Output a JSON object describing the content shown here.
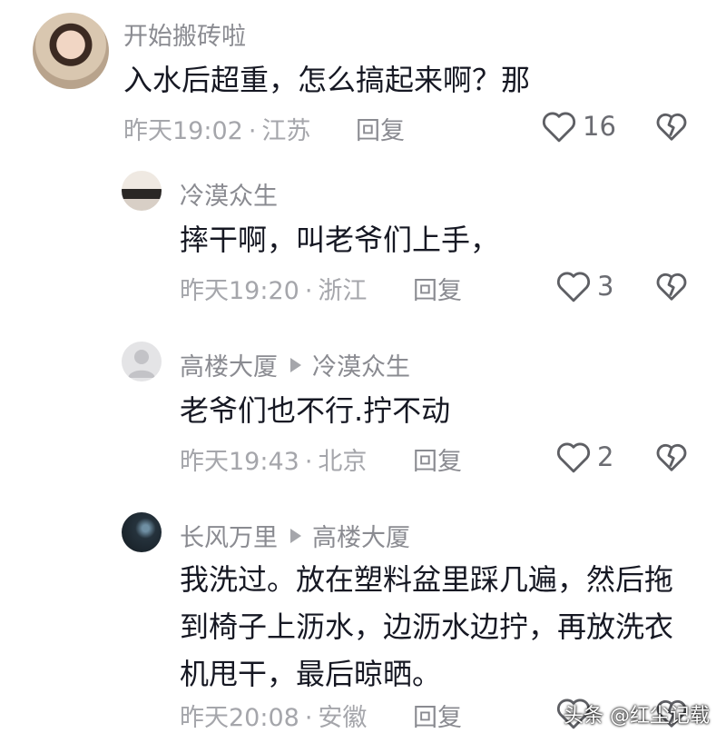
{
  "comments": [
    {
      "username": "开始搬砖啦",
      "text": "入水后超重，怎么搞起来啊？那",
      "time": "昨天19:02",
      "location": "江苏",
      "reply_label": "回复",
      "likes": "16"
    },
    {
      "username": "冷漠众生",
      "text": "摔干啊，叫老爷们上手，",
      "time": "昨天19:20",
      "location": "浙江",
      "reply_label": "回复",
      "likes": "3"
    },
    {
      "username": "高楼大厦",
      "reply_to": "冷漠众生",
      "text": "老爷们也不行.拧不动",
      "time": "昨天19:43",
      "location": "北京",
      "reply_label": "回复",
      "likes": "2"
    },
    {
      "username": "长风万里",
      "reply_to": "高楼大厦",
      "text": "我洗过。放在塑料盆里踩几遍，然后拖到椅子上沥水，边沥水边拧，再放洗衣机甩干，最后晾晒。",
      "time": "昨天20:08",
      "location": "安徽",
      "reply_label": "回复"
    }
  ],
  "meta_separator": "·",
  "watermark": "头条 @红尘记载",
  "icons": {
    "like": "heart-outline-icon",
    "dislike": "broken-heart-icon",
    "reply_indicator": "triangle-right-icon"
  },
  "colors": {
    "username": "#8a8b91",
    "content": "#161823",
    "meta": "#a5a6ab",
    "icon": "#5e5f64"
  }
}
